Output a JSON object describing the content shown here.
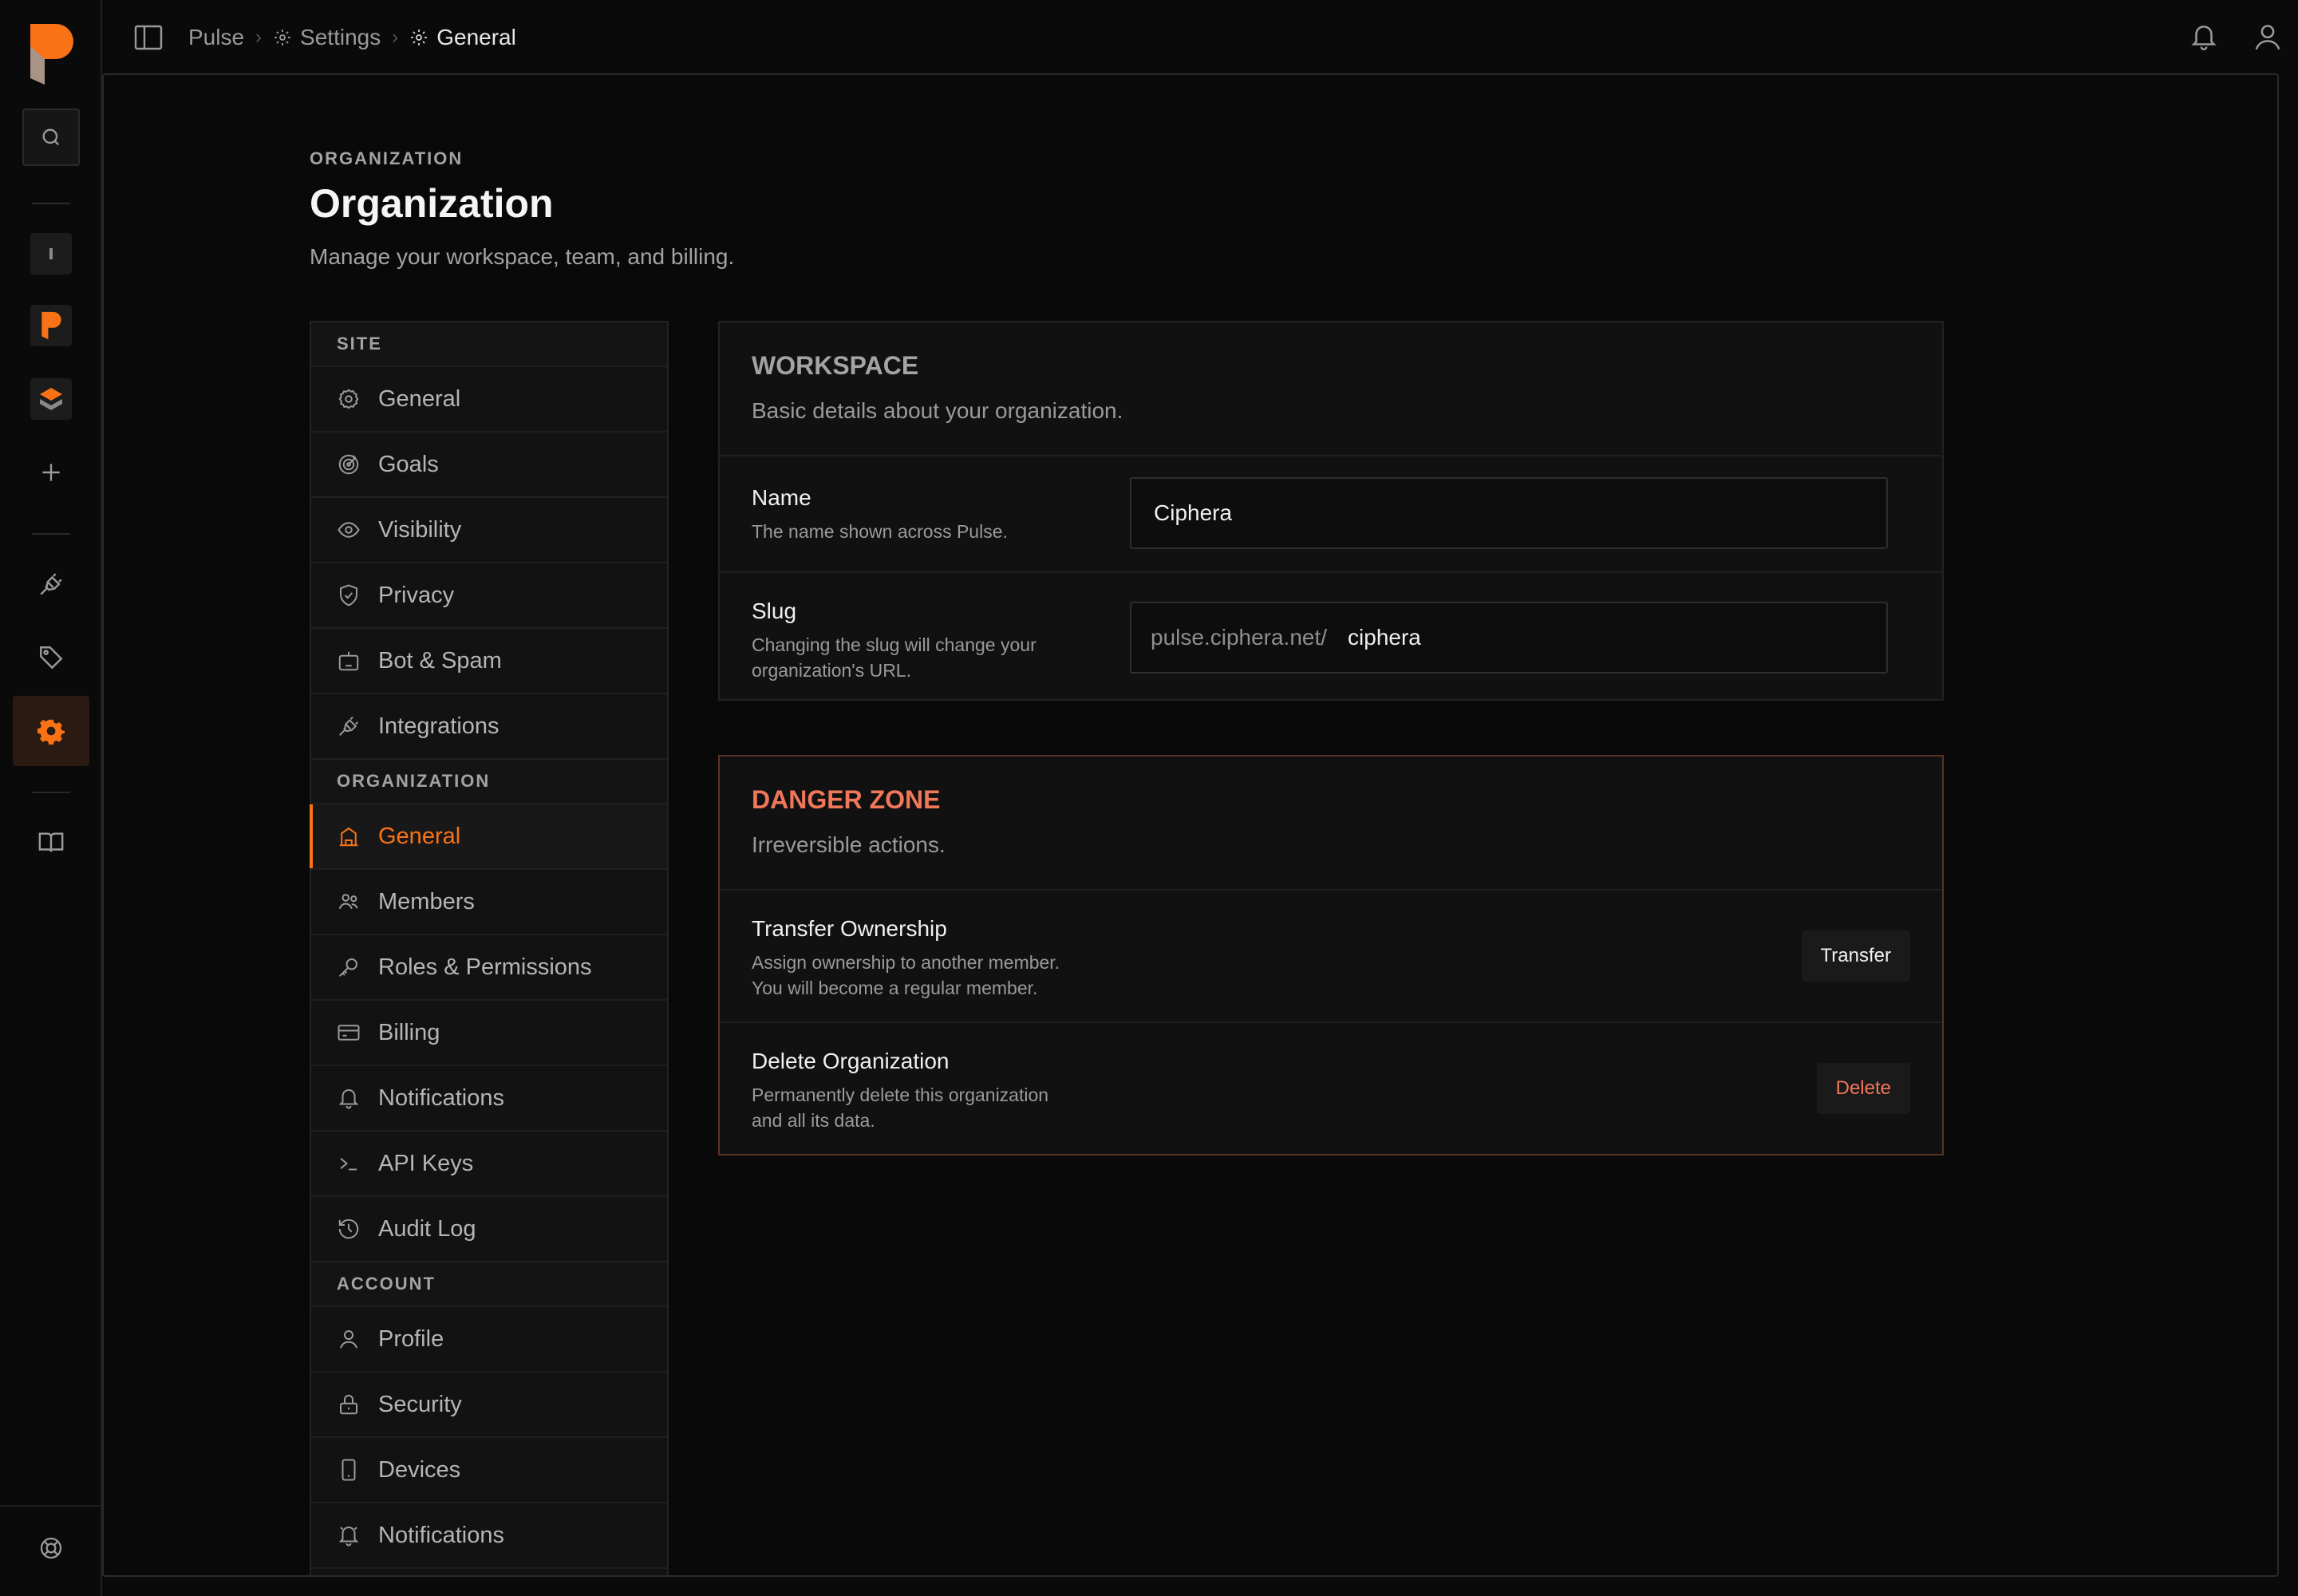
{
  "topbar": {
    "breadcrumb": [
      {
        "label": "Pulse"
      },
      {
        "label": "Settings"
      },
      {
        "label": "General"
      }
    ]
  },
  "page": {
    "eyebrow": "ORGANIZATION",
    "title": "Organization",
    "subtitle": "Manage your workspace, team, and billing."
  },
  "settings_nav": {
    "sections": [
      {
        "label": "SITE",
        "items": [
          {
            "label": "General",
            "icon": "gear-icon"
          },
          {
            "label": "Goals",
            "icon": "target-icon"
          },
          {
            "label": "Visibility",
            "icon": "eye-icon"
          },
          {
            "label": "Privacy",
            "icon": "shield-icon"
          },
          {
            "label": "Bot & Spam",
            "icon": "bot-icon"
          },
          {
            "label": "Integrations",
            "icon": "plug-icon"
          }
        ]
      },
      {
        "label": "ORGANIZATION",
        "items": [
          {
            "label": "General",
            "icon": "building-icon",
            "active": true
          },
          {
            "label": "Members",
            "icon": "users-icon"
          },
          {
            "label": "Roles & Permissions",
            "icon": "key-icon"
          },
          {
            "label": "Billing",
            "icon": "credit-card-icon"
          },
          {
            "label": "Notifications",
            "icon": "bell-icon"
          },
          {
            "label": "API Keys",
            "icon": "terminal-icon"
          },
          {
            "label": "Audit Log",
            "icon": "history-icon"
          }
        ]
      },
      {
        "label": "ACCOUNT",
        "items": [
          {
            "label": "Profile",
            "icon": "user-icon"
          },
          {
            "label": "Security",
            "icon": "lock-icon"
          },
          {
            "label": "Devices",
            "icon": "phone-icon"
          },
          {
            "label": "Notifications",
            "icon": "bell-icon"
          }
        ]
      }
    ]
  },
  "workspace": {
    "title": "WORKSPACE",
    "description": "Basic details about your organization.",
    "name_label": "Name",
    "name_help": "The name shown across Pulse.",
    "name_value": "Ciphera",
    "slug_label": "Slug",
    "slug_help": "Changing the slug will change your organization's URL.",
    "slug_prefix": "pulse.ciphera.net/",
    "slug_value": "ciphera"
  },
  "danger_zone": {
    "title": "DANGER ZONE",
    "description": "Irreversible actions.",
    "transfer_label": "Transfer Ownership",
    "transfer_help_1": "Assign ownership to another member.",
    "transfer_help_2": "You will become a regular member.",
    "transfer_button": "Transfer",
    "delete_label": "Delete Organization",
    "delete_help_1": "Permanently delete this organization",
    "delete_help_2": "and all its data.",
    "delete_button": "Delete"
  },
  "colors": {
    "accent": "#f97316",
    "danger": "#f0775a",
    "background": "#0a0a0a"
  }
}
